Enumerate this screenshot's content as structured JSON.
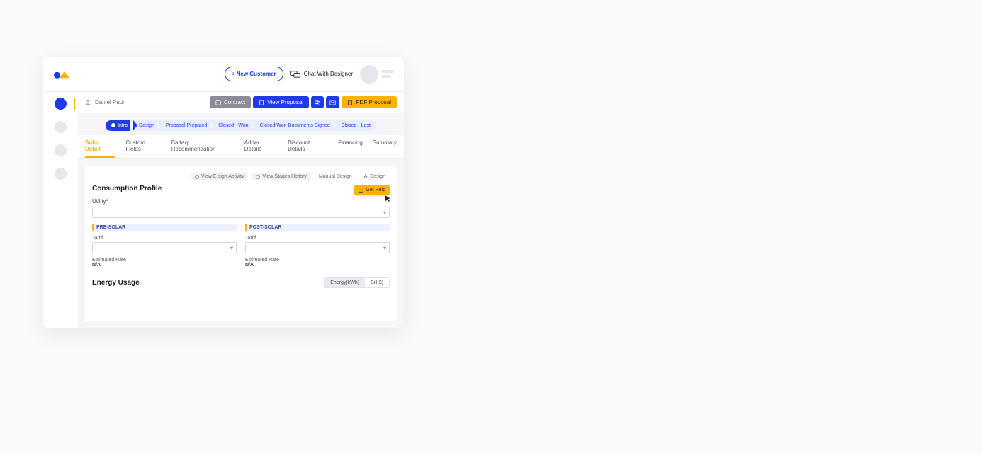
{
  "header": {
    "new_customer_label": "+ New Customer",
    "chat_label": "Chat With Designer"
  },
  "crumb": {
    "customer_name": "Daniel Paul"
  },
  "action_bar": {
    "contract": "Contract",
    "view_proposal": "View Proposal",
    "pdf_proposal": "PDF Proposal"
  },
  "pipeline": [
    "Intro",
    "Design",
    "Proposal Prepared",
    "Closed - Won",
    "Closed Won Documents Signed",
    "Closed - Lost"
  ],
  "tabs": [
    "Solar Detail",
    "Custom Fields",
    "Battery Recommendation",
    "Adder Details",
    "Discount Details",
    "Financing",
    "Summary"
  ],
  "card_toolbar": {
    "view_esign": "View E-sign Activity",
    "view_stages": "View Stages History",
    "manual_design": "Manual Design",
    "ai_design": "AI Design"
  },
  "consumption": {
    "title": "Consumption Profile",
    "get_help": "Get Help",
    "utility_label": "Utility*",
    "pre_solar": "PRE-SOLAR",
    "post_solar": "POST-SOLAR",
    "tariff_label": "Tariff",
    "estimated_rate_label": "Estimated Rate",
    "na": "N/A"
  },
  "energy": {
    "title": "Energy Usage",
    "seg_energy": "Energy(kWh)",
    "seg_bill": "Bill($)"
  }
}
